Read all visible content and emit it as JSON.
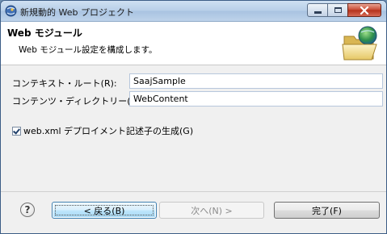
{
  "window": {
    "title": "新規動的 Web プロジェクト"
  },
  "header": {
    "title": "Web モジュール",
    "description": "Web モジュール設定を構成します。"
  },
  "form": {
    "context_root_label": "コンテキスト・ルート(R):",
    "context_root_value": "SaajSample",
    "content_dir_label": "コンテンツ・ディレクトリー(D):",
    "content_dir_value": "WebContent",
    "generate_webxml_label": "web.xml デプロイメント記述子の生成(G)",
    "generate_webxml_checked": true
  },
  "buttons": {
    "help": "?",
    "back": "< 戻る(B)",
    "next": "次へ(N) >",
    "finish": "完了(F)"
  },
  "colors": {
    "title_accent": "#3c5d86",
    "back_button_border": "#3c7fb1"
  },
  "icons": {
    "title": "eclipse-globe-icon",
    "header": "folder-globe-icon",
    "help": "help-icon",
    "minimize": "minimize-icon",
    "maximize": "maximize-icon",
    "close": "close-icon"
  }
}
